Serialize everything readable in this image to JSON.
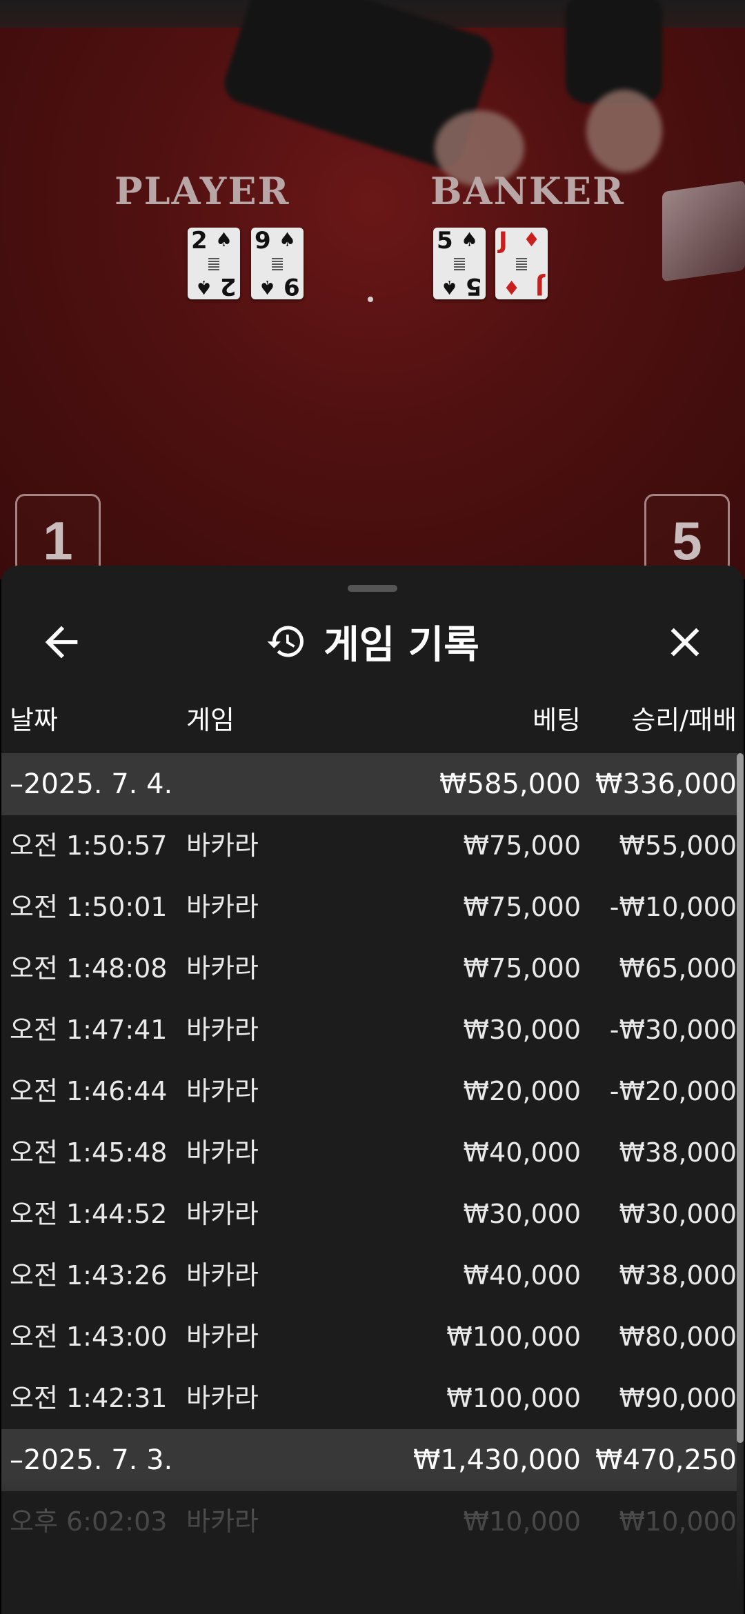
{
  "table": {
    "player_label": "PLAYER",
    "banker_label": "BANKER",
    "player_cards": [
      {
        "rank": "2",
        "suit": "♠",
        "color": "black"
      },
      {
        "rank": "9",
        "suit": "♠",
        "color": "black"
      }
    ],
    "banker_cards": [
      {
        "rank": "5",
        "suit": "♠",
        "color": "black"
      },
      {
        "rank": "J",
        "suit": "♦",
        "color": "red"
      }
    ],
    "seat_left": "1",
    "seat_right": "5"
  },
  "header": {
    "title": "게임 기록",
    "back_icon": "arrow-left-icon",
    "history_icon": "history-icon",
    "close_icon": "close-icon"
  },
  "columns": {
    "date": "날짜",
    "game": "게임",
    "bet": "베팅",
    "win_loss": "승리/패배"
  },
  "groups": [
    {
      "date": "–2025. 7. 4.",
      "bet_total": "₩585,000",
      "win_total": "₩336,000",
      "rows": [
        {
          "time": "오전 1:50:57",
          "game": "바카라",
          "bet": "₩75,000",
          "win": "₩55,000"
        },
        {
          "time": "오전 1:50:01",
          "game": "바카라",
          "bet": "₩75,000",
          "win": "-₩10,000"
        },
        {
          "time": "오전 1:48:08",
          "game": "바카라",
          "bet": "₩75,000",
          "win": "₩65,000"
        },
        {
          "time": "오전 1:47:41",
          "game": "바카라",
          "bet": "₩30,000",
          "win": "-₩30,000"
        },
        {
          "time": "오전 1:46:44",
          "game": "바카라",
          "bet": "₩20,000",
          "win": "-₩20,000"
        },
        {
          "time": "오전 1:45:48",
          "game": "바카라",
          "bet": "₩40,000",
          "win": "₩38,000"
        },
        {
          "time": "오전 1:44:52",
          "game": "바카라",
          "bet": "₩30,000",
          "win": "₩30,000"
        },
        {
          "time": "오전 1:43:26",
          "game": "바카라",
          "bet": "₩40,000",
          "win": "₩38,000"
        },
        {
          "time": "오전 1:43:00",
          "game": "바카라",
          "bet": "₩100,000",
          "win": "₩80,000"
        },
        {
          "time": "오전 1:42:31",
          "game": "바카라",
          "bet": "₩100,000",
          "win": "₩90,000"
        }
      ]
    },
    {
      "date": "–2025. 7. 3.",
      "bet_total": "₩1,430,000",
      "win_total": "₩470,250",
      "rows": [
        {
          "time": "오후 6:02:03",
          "game": "바카라",
          "bet": "₩10,000",
          "win": "₩10,000"
        }
      ]
    }
  ]
}
